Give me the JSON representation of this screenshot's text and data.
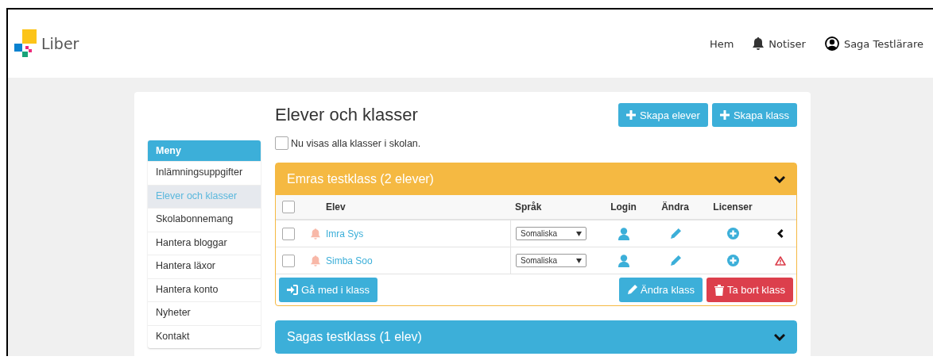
{
  "header": {
    "logo_text": "Liber",
    "nav": [
      {
        "label": "Hem",
        "kind": "plain"
      },
      {
        "label": "Notiser",
        "kind": "notifications"
      },
      {
        "label": "Saga Testlärare",
        "kind": "account"
      }
    ]
  },
  "sidebar": {
    "title": "Meny",
    "items": [
      {
        "label": "Inlämningsuppgifter",
        "selected": false
      },
      {
        "label": "Elever och klasser",
        "selected": true
      },
      {
        "label": "Skolabonnemang",
        "selected": false
      },
      {
        "label": "Hantera bloggar",
        "selected": false
      },
      {
        "label": "Hantera läxor",
        "selected": false
      },
      {
        "label": "Hantera konto",
        "selected": false
      },
      {
        "label": "Nyheter",
        "selected": false
      },
      {
        "label": "Kontakt",
        "selected": false
      }
    ]
  },
  "page": {
    "title": "Elever och klasser",
    "buttons": [
      {
        "label": "Skapa elever"
      },
      {
        "label": "Skapa klass"
      }
    ],
    "show_all": {
      "label": "Nu visas alla klasser i skolan.",
      "checked": false
    }
  },
  "classes": [
    {
      "title": "Emras testklass (2 elever)",
      "color": "#f5b942",
      "columns": [
        "Elev",
        "Språk",
        "Login",
        "Ändra",
        "Licenser"
      ],
      "select_all_checked": false,
      "rows": [
        {
          "name": "Imra Sys",
          "checked": false,
          "language": "Somaliska",
          "kind": "expandable"
        },
        {
          "name": "Simba Soo",
          "checked": false,
          "language": "Somaliska",
          "kind": "warning"
        }
      ],
      "buttons": [
        {
          "label": "Gå med i klass",
          "kind": "join"
        },
        {
          "label": "Ändra klass",
          "kind": "edit"
        },
        {
          "label": "Ta bort klass",
          "kind": "delete"
        }
      ]
    },
    {
      "title": "Sagas testklass (1 elev)",
      "color": "#3cafd9"
    }
  ]
}
